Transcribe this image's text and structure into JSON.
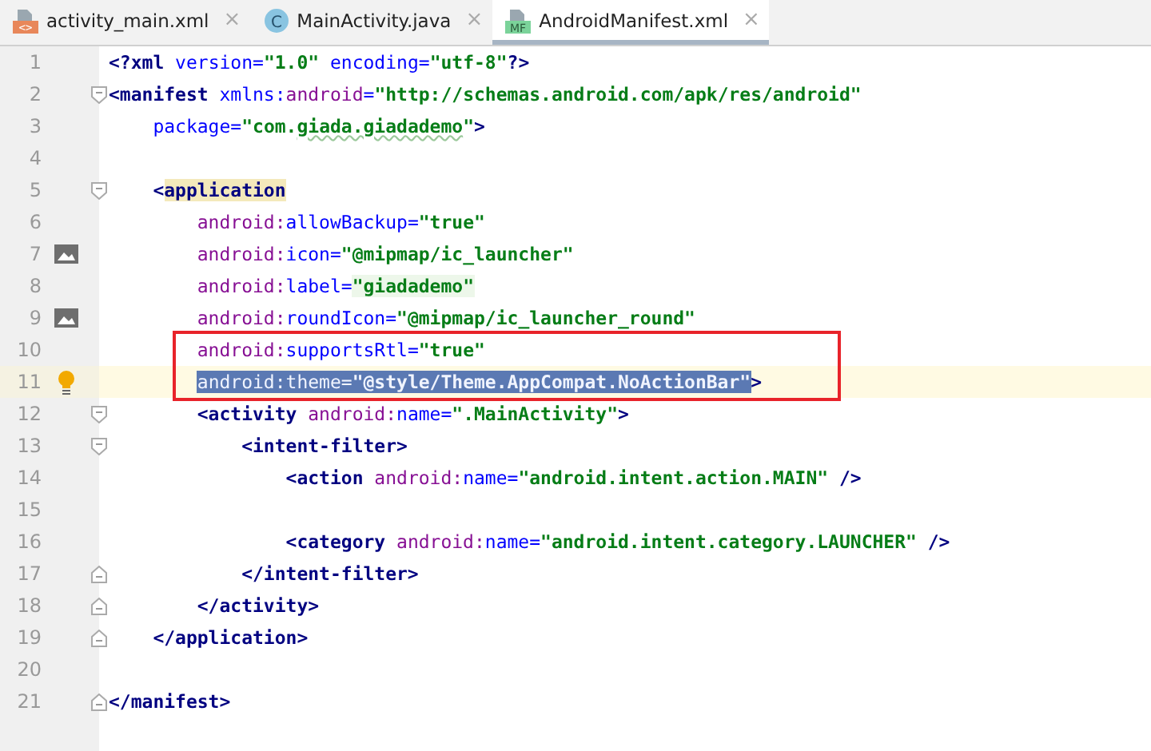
{
  "tabs": [
    {
      "label": "activity_main.xml",
      "kind": "xml",
      "icon_text": "<>",
      "selected": false,
      "close": "×"
    },
    {
      "label": "MainActivity.java",
      "kind": "class",
      "icon_text": "C",
      "selected": false,
      "close": "×"
    },
    {
      "label": "AndroidManifest.xml",
      "kind": "manifest",
      "icon_text": "MF",
      "selected": true,
      "close": "×"
    }
  ],
  "editor": {
    "lines": [
      {
        "number": "1",
        "tokens": [
          {
            "kind": "tag",
            "t": "<?xml"
          },
          {
            "kind": "attr",
            "t": " version="
          },
          {
            "kind": "value",
            "t": "\"1.0\""
          },
          {
            "kind": "attr",
            "t": " encoding="
          },
          {
            "kind": "value",
            "t": "\"utf-8\""
          },
          {
            "kind": "tag",
            "t": "?>"
          }
        ]
      },
      {
        "number": "2",
        "fold": {
          "kind": "start"
        },
        "tokens": [
          {
            "kind": "tag",
            "t": "<manifest"
          },
          {
            "kind": "attr",
            "t": " xmlns:"
          },
          {
            "kind": "ns",
            "t": "android"
          },
          {
            "kind": "attr",
            "t": "="
          },
          {
            "kind": "value",
            "t": "\"http://schemas.android.com/apk/res/android\""
          }
        ]
      },
      {
        "number": "3",
        "tokens": [
          {
            "kind": "attr",
            "t": "    package="
          },
          {
            "kind": "value",
            "t": "\"com."
          },
          {
            "kind": "value",
            "t": "giada.giadademo",
            "misspelled": true
          },
          {
            "kind": "value",
            "t": "\""
          },
          {
            "kind": "tag",
            "t": ">"
          }
        ]
      },
      {
        "number": "4"
      },
      {
        "number": "5",
        "fold": {
          "kind": "start"
        },
        "tokens": [
          {
            "kind": "tag",
            "t": "    <"
          },
          {
            "kind": "tag",
            "t": "application",
            "highlighted": true
          }
        ]
      },
      {
        "number": "6",
        "tokens": [
          {
            "kind": "ns",
            "t": "        android:"
          },
          {
            "kind": "attr",
            "t": "allowBackup="
          },
          {
            "kind": "value",
            "t": "\"true\""
          }
        ]
      },
      {
        "number": "7",
        "gutter": {
          "kind": "image"
        },
        "tokens": [
          {
            "kind": "ns",
            "t": "        android:"
          },
          {
            "kind": "attr",
            "t": "icon="
          },
          {
            "kind": "value",
            "t": "\"@mipmap/ic_launcher\""
          }
        ]
      },
      {
        "number": "8",
        "tokens": [
          {
            "kind": "ns",
            "t": "        android:"
          },
          {
            "kind": "attr",
            "t": "label="
          },
          {
            "kind": "value",
            "t": "\"giadademo\"",
            "folded": true
          }
        ]
      },
      {
        "number": "9",
        "gutter": {
          "kind": "image"
        },
        "tokens": [
          {
            "kind": "ns",
            "t": "        android:"
          },
          {
            "kind": "attr",
            "t": "roundIcon="
          },
          {
            "kind": "value",
            "t": "\"@mipmap/ic_launcher_round\""
          }
        ]
      },
      {
        "number": "10",
        "boxed": true,
        "tokens": [
          {
            "kind": "ns",
            "t": "        android:"
          },
          {
            "kind": "attr",
            "t": "supportsRtl="
          },
          {
            "kind": "value",
            "t": "\"true\""
          }
        ]
      },
      {
        "number": "11",
        "boxed": true,
        "current": true,
        "gutter": {
          "kind": "bulb"
        },
        "tokens": [
          {
            "kind": "ns",
            "t": "        android:",
            "selected": true
          },
          {
            "kind": "attr",
            "t": "theme=",
            "selected": true
          },
          {
            "kind": "value",
            "t": "\"@style/Theme.AppCompat.NoActionBar\"",
            "selected": true
          },
          {
            "kind": "tag",
            "t": ">"
          }
        ]
      },
      {
        "number": "12",
        "fold": {
          "kind": "start"
        },
        "tokens": [
          {
            "kind": "tag",
            "t": "        <activity"
          },
          {
            "kind": "ns",
            "t": " android:"
          },
          {
            "kind": "attr",
            "t": "name="
          },
          {
            "kind": "value",
            "t": "\".MainActivity\""
          },
          {
            "kind": "tag",
            "t": ">"
          }
        ]
      },
      {
        "number": "13",
        "fold": {
          "kind": "start"
        },
        "tokens": [
          {
            "kind": "tag",
            "t": "            <intent-filter>"
          }
        ]
      },
      {
        "number": "14",
        "tokens": [
          {
            "kind": "tag",
            "t": "                <action"
          },
          {
            "kind": "ns",
            "t": " android:"
          },
          {
            "kind": "attr",
            "t": "name="
          },
          {
            "kind": "value",
            "t": "\"android.intent.action.MAIN\""
          },
          {
            "kind": "tag",
            "t": " />"
          }
        ]
      },
      {
        "number": "15"
      },
      {
        "number": "16",
        "tokens": [
          {
            "kind": "tag",
            "t": "                <category"
          },
          {
            "kind": "ns",
            "t": " android:"
          },
          {
            "kind": "attr",
            "t": "name="
          },
          {
            "kind": "value",
            "t": "\"android.intent.category.LAUNCHER\""
          },
          {
            "kind": "tag",
            "t": " />"
          }
        ]
      },
      {
        "number": "17",
        "fold": {
          "kind": "end"
        },
        "tokens": [
          {
            "kind": "tag",
            "t": "            </intent-filter>"
          }
        ]
      },
      {
        "number": "18",
        "fold": {
          "kind": "end"
        },
        "tokens": [
          {
            "kind": "tag",
            "t": "        </activity>"
          }
        ]
      },
      {
        "number": "19",
        "fold": {
          "kind": "end"
        },
        "tokens": [
          {
            "kind": "tag",
            "t": "    </application>"
          }
        ]
      },
      {
        "number": "20"
      },
      {
        "number": "21",
        "fold": {
          "kind": "end"
        },
        "tokens": [
          {
            "kind": "tag",
            "t": "</manifest>"
          }
        ]
      }
    ]
  }
}
